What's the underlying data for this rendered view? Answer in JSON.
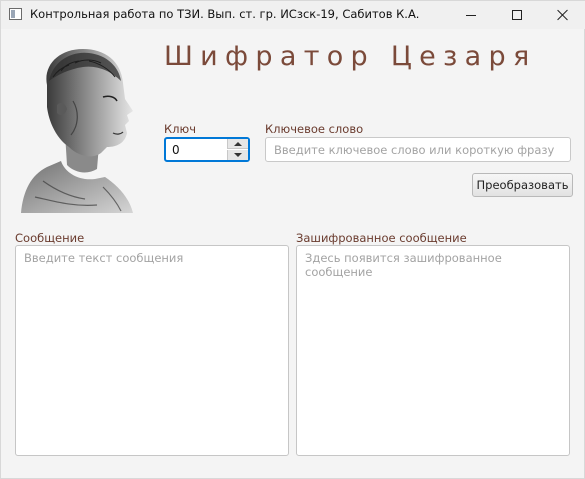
{
  "window": {
    "title": "Контрольная работа по ТЗИ. Вып. ст. гр. ИСзск-19, Сабитов К.А.",
    "minimize_icon": "minimize-icon",
    "maximize_icon": "maximize-icon",
    "close_icon": "close-icon"
  },
  "header": {
    "title": "Шифратор Цезаря",
    "portrait": "caesar-bust-portrait"
  },
  "key": {
    "label": "Ключ",
    "value": "0",
    "up_icon": "spinner-up-arrow-icon",
    "down_icon": "spinner-down-arrow-icon"
  },
  "keyword": {
    "label": "Ключевое слово",
    "placeholder": "Введите ключевое слово или короткую фразу",
    "value": ""
  },
  "actions": {
    "convert_label": "Преобразовать"
  },
  "message": {
    "label": "Сообщение",
    "placeholder": "Введите текст сообщения",
    "value": ""
  },
  "encrypted": {
    "label": "Зашифрованное сообщение",
    "placeholder": "Здесь появится зашифрованное сообщение",
    "value": ""
  },
  "colors": {
    "heading": "#7b4a3a",
    "labels": "#6a3b2e",
    "focus_accent": "#0078d7"
  }
}
